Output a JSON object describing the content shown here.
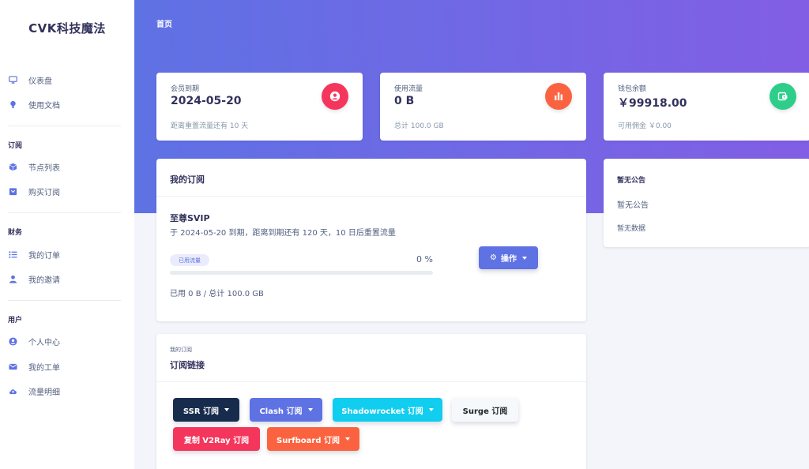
{
  "brand": "CVK科技魔法",
  "header": {
    "title": "首页"
  },
  "sidebar": {
    "items_top": [
      {
        "label": "仪表盘",
        "icon": "monitor-icon"
      },
      {
        "label": "使用文档",
        "icon": "bulb-icon"
      }
    ],
    "sections": [
      {
        "title": "订阅",
        "items": [
          {
            "label": "节点列表",
            "icon": "cube-icon"
          },
          {
            "label": "购买订阅",
            "icon": "box-icon"
          }
        ]
      },
      {
        "title": "财务",
        "items": [
          {
            "label": "我的订单",
            "icon": "list-icon"
          },
          {
            "label": "我的邀请",
            "icon": "user-icon"
          }
        ]
      },
      {
        "title": "用户",
        "items": [
          {
            "label": "个人中心",
            "icon": "user-circle-icon"
          },
          {
            "label": "我的工单",
            "icon": "mail-icon"
          },
          {
            "label": "流量明细",
            "icon": "cloud-upload-icon"
          }
        ]
      }
    ]
  },
  "stats": [
    {
      "label": "会员到期",
      "value": "2024-05-20",
      "sub": "距离重置流量还有 10 天",
      "icon": "user-icon",
      "color": "#f5365c"
    },
    {
      "label": "使用流量",
      "value": "0 B",
      "sub": "总计 100.0 GB",
      "icon": "chart-bar-icon",
      "color": "#fb6340"
    },
    {
      "label": "钱包余额",
      "value": "￥99918.00",
      "sub": "可用佣金 ￥0.00",
      "icon": "wallet-icon",
      "color": "#2dce89"
    }
  ],
  "subscription": {
    "header": "我的订阅",
    "plan_name": "至尊SVIP",
    "plan_desc": "于 2024-05-20 到期，距离到期还有 120 天，10 日后重置流量",
    "pill": "已用流量",
    "percent_text": "0 %",
    "percent": 0,
    "usage": "已用 0 B / 总计 100.0 GB",
    "action_label": "操作"
  },
  "links": {
    "kicker": "我的订阅",
    "title": "订阅链接",
    "buttons": [
      {
        "label": "SSR 订阅",
        "color": "#172b4d",
        "text_color": "#ffffff",
        "dropdown": true
      },
      {
        "label": "Clash 订阅",
        "color": "#5e72e4",
        "text_color": "#ffffff",
        "dropdown": true
      },
      {
        "label": "Shadowrocket 订阅",
        "color": "#11cdef",
        "text_color": "#ffffff",
        "dropdown": true
      },
      {
        "label": "Surge 订阅",
        "color": "#f6f9fc",
        "text_color": "#212529",
        "dropdown": false
      },
      {
        "label": "复制 V2Ray 订阅",
        "color": "#f5365c",
        "text_color": "#ffffff",
        "dropdown": false
      },
      {
        "label": "Surfboard 订阅",
        "color": "#fb6340",
        "text_color": "#ffffff",
        "dropdown": true
      }
    ]
  },
  "notice": {
    "title": "暂无公告",
    "text": "暂无公告",
    "empty": "暂无数据"
  }
}
